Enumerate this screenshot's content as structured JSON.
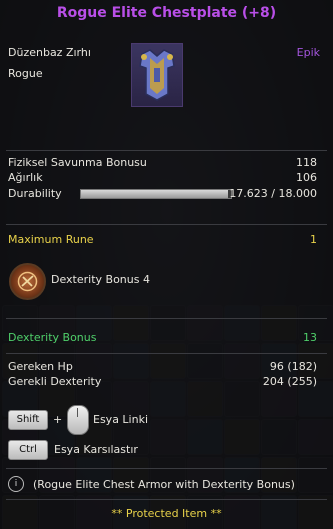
{
  "tooltip": {
    "title": "Rogue Elite Chestplate (+8)",
    "name_tr": "Düzenbaz Zırhı",
    "class": "Rogue",
    "rarity": "Epik",
    "icon": "chestplate-armor-icon"
  },
  "stats": [
    {
      "label": "Fiziksel Savunma Bonusu",
      "value": "118"
    },
    {
      "label": "Ağırlık",
      "value": "106"
    },
    {
      "label": "Durability",
      "value": "17.623 / 18.000"
    }
  ],
  "durability_fraction": 0.979,
  "rune": {
    "title": "Maximum Rune",
    "count": "1",
    "bonus_label": "Dexterity Bonus 4",
    "icon": "rune-seal-icon"
  },
  "bonus": {
    "label": "Dexterity Bonus",
    "value": "13"
  },
  "requirements": [
    {
      "label": "Gereken Hp",
      "value": "96 (182)"
    },
    {
      "label": "Gerekli  Dexterity",
      "value": "204 (255)"
    }
  ],
  "hints": {
    "shift_key": "Shift",
    "plus": "+",
    "link_label": "Esya Linki",
    "ctrl_key": "Ctrl",
    "compare_label": "Esya Karsılastır"
  },
  "description": "(Rogue Elite Chest Armor with Dexterity Bonus)",
  "protected": "** Protected Item **",
  "colors": {
    "title": "#b94fe8",
    "rune": "#e8d24a",
    "bonus": "#4fcf6a"
  }
}
